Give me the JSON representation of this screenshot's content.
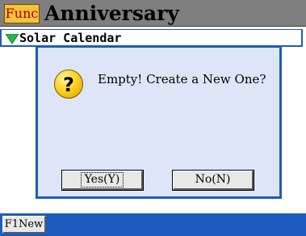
{
  "titlebar": {
    "func_label": "Func",
    "title": "Anniversary"
  },
  "subheader": {
    "icon": "triangle-down-icon",
    "label": "Solar Calendar"
  },
  "dialog": {
    "icon": "question-icon",
    "icon_glyph": "?",
    "message": "Empty! Create a New One?",
    "yes_label": "Yes(Y)",
    "no_label": "No(N)"
  },
  "bottombar": {
    "f1_label": "F1New"
  },
  "colors": {
    "accent_blue": "#1d5bbf",
    "dialog_bg": "#dfe5f8",
    "titlebar_bg": "#7f7f7f",
    "func_button": "#f6c23a",
    "func_text": "#b00000",
    "triangle_green": "#2bb34a"
  }
}
